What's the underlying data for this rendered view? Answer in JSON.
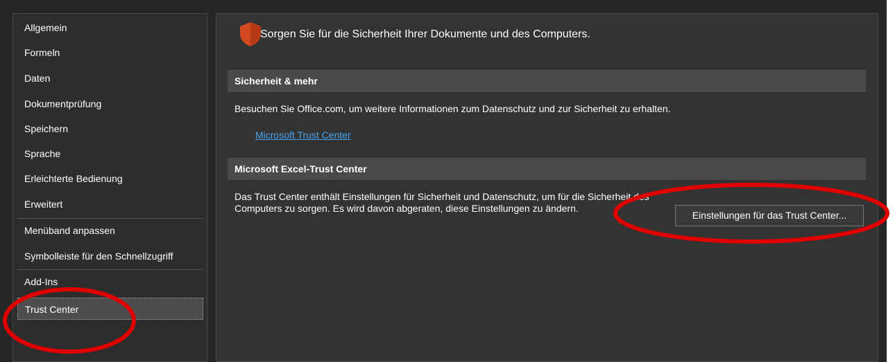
{
  "sidebar": {
    "items": [
      {
        "label": "Allgemein"
      },
      {
        "label": "Formeln"
      },
      {
        "label": "Daten"
      },
      {
        "label": "Dokumentprüfung"
      },
      {
        "label": "Speichern"
      },
      {
        "label": "Sprache"
      },
      {
        "label": "Erleichterte Bedienung"
      },
      {
        "label": "Erweitert"
      },
      {
        "label": "Menüband anpassen"
      },
      {
        "label": "Symbolleiste für den Schnellzugriff"
      },
      {
        "label": "Add-Ins"
      },
      {
        "label": "Trust Center"
      }
    ],
    "selected": "Trust Center"
  },
  "main": {
    "title": "Sorgen Sie für die Sicherheit Ihrer Dokumente und des Computers.",
    "title_icon": "shield-icon",
    "section_security": {
      "header": "Sicherheit & mehr",
      "text": "Besuchen Sie Office.com, um weitere Informationen zum Datenschutz und zur Sicherheit zu erhalten.",
      "link": "Microsoft Trust Center"
    },
    "section_trust_center": {
      "header": "Microsoft Excel-Trust Center",
      "text": "Das Trust Center enthält Einstellungen für Sicherheit und Datenschutz, um für die Sicherheit des Computers zu sorgen. Es wird davon abgeraten, diese Einstellungen zu ändern.",
      "button": "Einstellungen für das Trust Center..."
    }
  },
  "colors": {
    "background": "#262626",
    "panel": "#333333",
    "section_header": "#4a4a4a",
    "link": "#4aa3f0",
    "shield": "#d2491f",
    "annotation": "#e00000"
  }
}
